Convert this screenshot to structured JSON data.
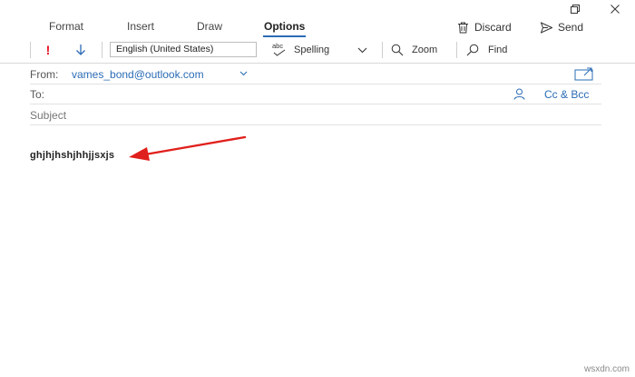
{
  "window": {
    "controls": [
      "restore-icon",
      "close-icon"
    ]
  },
  "tabs": [
    {
      "label": "Format",
      "active": false
    },
    {
      "label": "Insert",
      "active": false
    },
    {
      "label": "Draw",
      "active": false
    },
    {
      "label": "Options",
      "active": true
    }
  ],
  "actions": {
    "discard_label": "Discard",
    "send_label": "Send"
  },
  "toolbar": {
    "importance_high_symbol": "!",
    "language_value": "English (United States)",
    "spelling_label": "Spelling",
    "spelling_icon_text": "abc",
    "zoom_label": "Zoom",
    "find_label": "Find"
  },
  "message": {
    "from_label": "From:",
    "from_value": "vames_bond@outlook.com",
    "to_label": "To:",
    "cc_bcc_label": "Cc & Bcc",
    "subject_placeholder": "Subject",
    "body_text": "ghjhjhshjhhjjsxjs"
  },
  "colors": {
    "accent": "#2b6cb5",
    "importance": "#e81123",
    "arrow": "#e0201c"
  },
  "watermark": "wsxdn.com"
}
